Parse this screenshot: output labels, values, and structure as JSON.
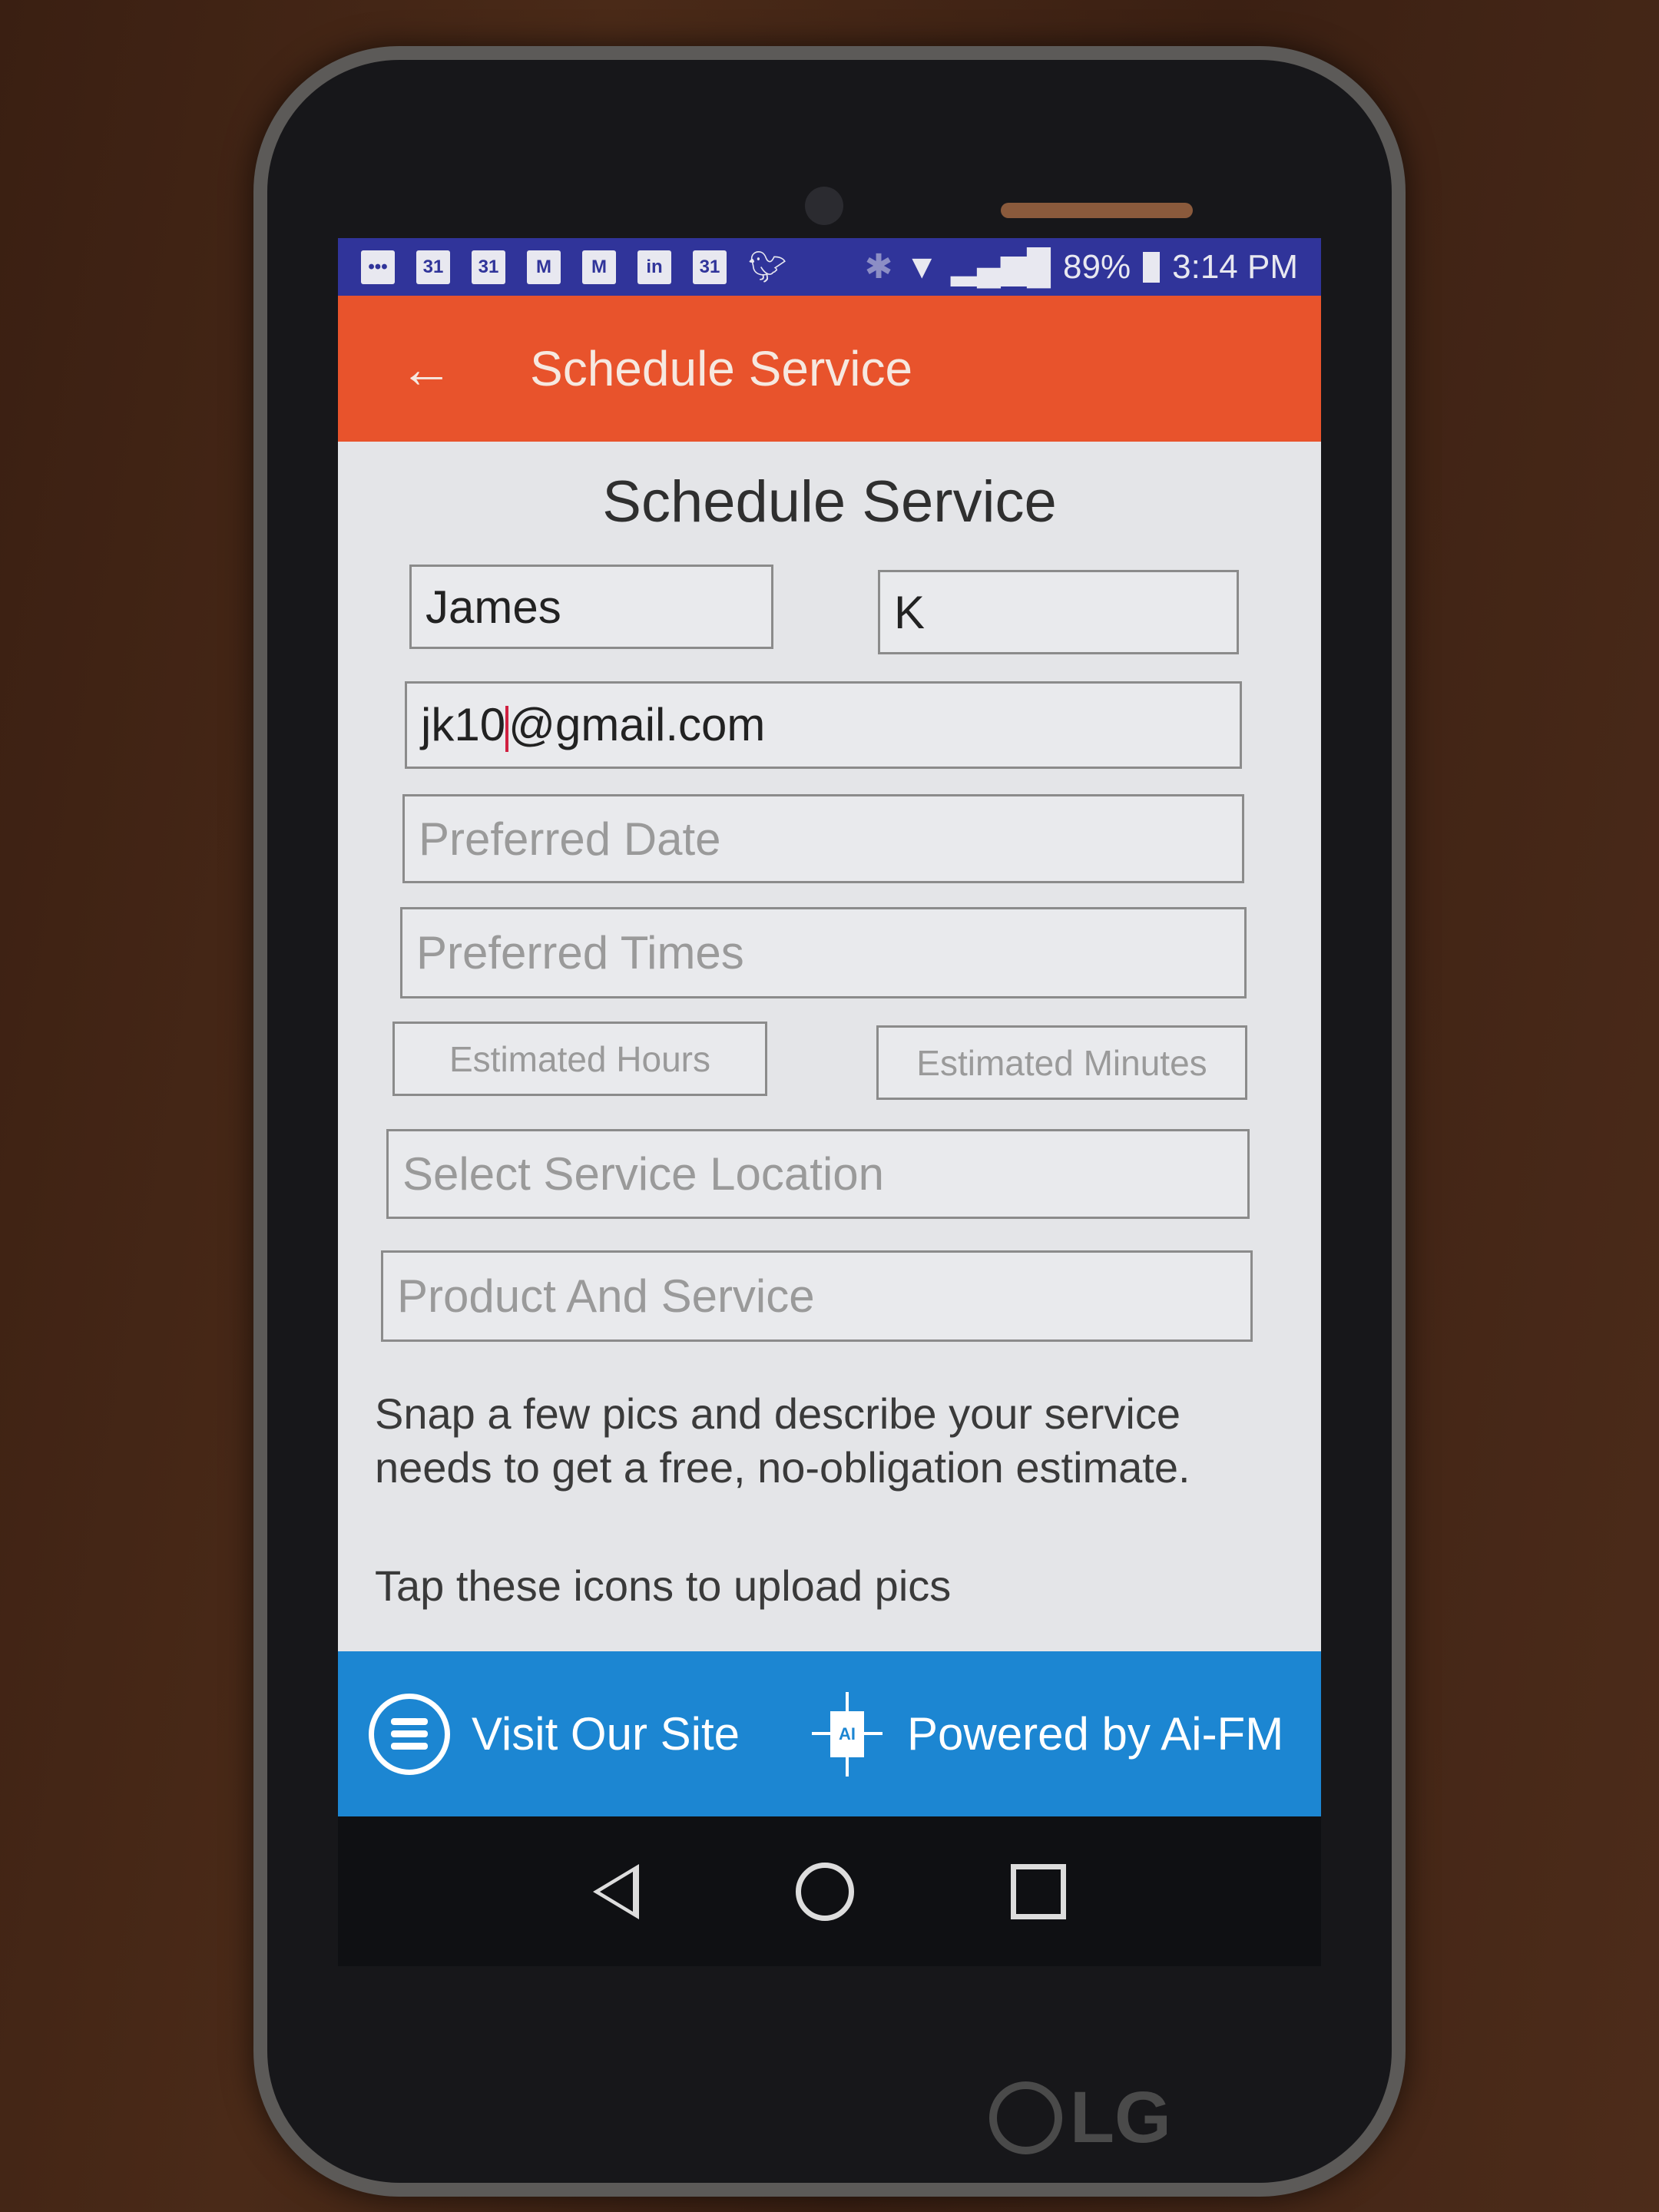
{
  "status_bar": {
    "notification_icons": [
      "more-icon",
      "calendar-icon",
      "calendar-icon",
      "gmail-icon",
      "gmail-icon",
      "linkedin-icon",
      "calendar-icon",
      "twitter-icon"
    ],
    "calendar_day": "31",
    "battery": "89%",
    "time": "3:14 PM",
    "color": "#30349a"
  },
  "app_bar": {
    "title": "Schedule Service",
    "color": "#e8532c"
  },
  "form": {
    "heading": "Schedule Service",
    "first_name": "James",
    "last_name": "K",
    "email_before_cursor": "jk10",
    "email_after_cursor": "@gmail.com",
    "preferred_date_placeholder": "Preferred Date",
    "preferred_times_placeholder": "Preferred Times",
    "estimated_hours_placeholder": "Estimated Hours",
    "estimated_minutes_placeholder": "Estimated Minutes",
    "service_location_placeholder": "Select Service Location",
    "product_service_placeholder": "Product And Service",
    "description": "Snap a few pics and describe your service needs to get a free, no-obligation estimate.",
    "upload_hint": "Tap these icons to upload pics"
  },
  "footer": {
    "visit_label": "Visit Our Site",
    "powered_label": "Powered by Ai-FM",
    "ai_badge": "AI",
    "color": "#1c86d2"
  },
  "device": {
    "brand": "LG"
  }
}
